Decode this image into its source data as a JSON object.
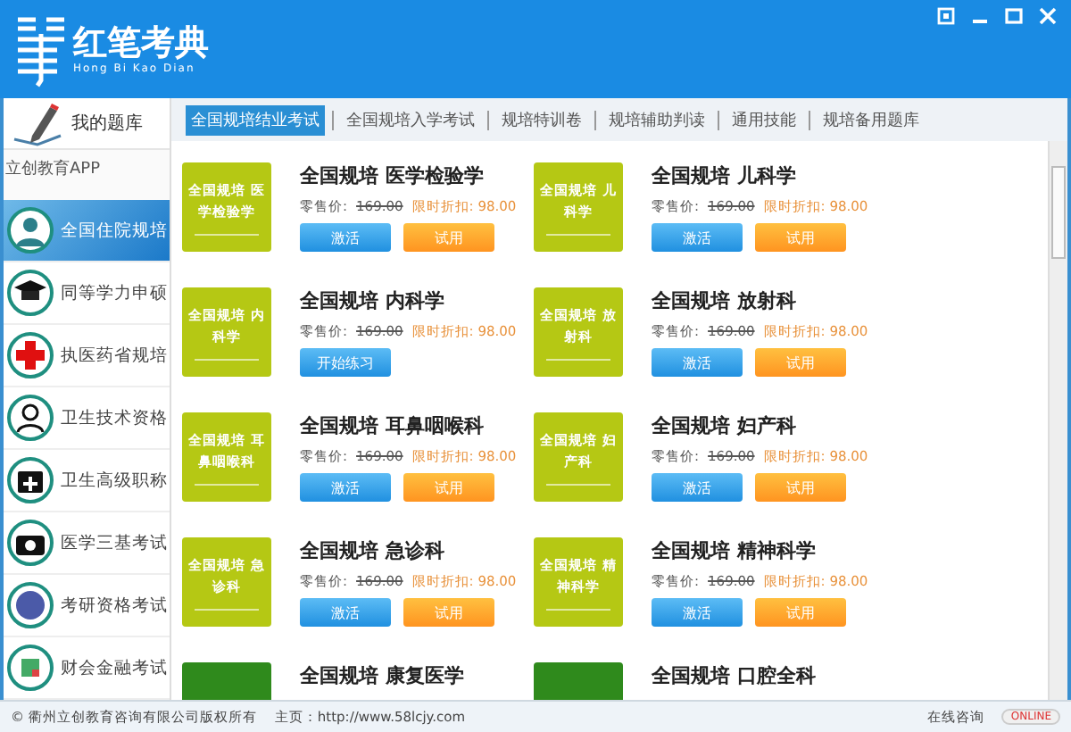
{
  "app": {
    "logo_title": "红笔考典",
    "logo_subtitle": "Hong Bi Kao Dian"
  },
  "sidebar": {
    "header": "我的题库",
    "app_label": "立创教育APP",
    "items": [
      {
        "label": "全国住院规培",
        "selected": true
      },
      {
        "label": "同等学力申硕",
        "selected": false
      },
      {
        "label": "执医药省规培",
        "selected": false
      },
      {
        "label": "卫生技术资格",
        "selected": false
      },
      {
        "label": "卫生高级职称",
        "selected": false
      },
      {
        "label": "医学三基考试",
        "selected": false
      },
      {
        "label": "考研资格考试",
        "selected": false
      },
      {
        "label": "财会金融考试",
        "selected": false
      }
    ]
  },
  "tabs": [
    {
      "label": "全国规培结业考试",
      "selected": true
    },
    {
      "label": "全国规培入学考试",
      "selected": false
    },
    {
      "label": "规培特训卷",
      "selected": false
    },
    {
      "label": "规培辅助判读",
      "selected": false
    },
    {
      "label": "通用技能",
      "selected": false
    },
    {
      "label": "规培备用题库",
      "selected": false
    }
  ],
  "cards": [
    {
      "thumb_text": "全国规培 医学检验学",
      "color": "#b5c814",
      "title": "全国规培 医学检验学",
      "price_label": "零售价:",
      "price": "169.00",
      "sale_label": "限时折扣:",
      "sale_price": "98.00",
      "buttons": [
        {
          "kind": "primary",
          "label": "激活"
        },
        {
          "kind": "secondary",
          "label": "试用"
        }
      ]
    },
    {
      "thumb_text": "全国规培 儿科学",
      "color": "#b5c814",
      "title": "全国规培 儿科学",
      "price_label": "零售价:",
      "price": "169.00",
      "sale_label": "限时折扣:",
      "sale_price": "98.00",
      "buttons": [
        {
          "kind": "primary",
          "label": "激活"
        },
        {
          "kind": "secondary",
          "label": "试用"
        }
      ]
    },
    {
      "thumb_text": "全国规培 内科学",
      "color": "#b5c814",
      "title": "全国规培 内科学",
      "price_label": "零售价:",
      "price": "169.00",
      "sale_label": "限时折扣:",
      "sale_price": "98.00",
      "buttons": [
        {
          "kind": "primary",
          "label": "开始练习"
        }
      ]
    },
    {
      "thumb_text": "全国规培 放射科",
      "color": "#b5c814",
      "title": "全国规培 放射科",
      "price_label": "零售价:",
      "price": "169.00",
      "sale_label": "限时折扣:",
      "sale_price": "98.00",
      "buttons": [
        {
          "kind": "primary",
          "label": "激活"
        },
        {
          "kind": "secondary",
          "label": "试用"
        }
      ]
    },
    {
      "thumb_text": "全国规培 耳鼻咽喉科",
      "color": "#b5c814",
      "title": "全国规培 耳鼻咽喉科",
      "price_label": "零售价:",
      "price": "169.00",
      "sale_label": "限时折扣:",
      "sale_price": "98.00",
      "buttons": [
        {
          "kind": "primary",
          "label": "激活"
        },
        {
          "kind": "secondary",
          "label": "试用"
        }
      ]
    },
    {
      "thumb_text": "全国规培 妇产科",
      "color": "#b5c814",
      "title": "全国规培 妇产科",
      "price_label": "零售价:",
      "price": "169.00",
      "sale_label": "限时折扣:",
      "sale_price": "98.00",
      "buttons": [
        {
          "kind": "primary",
          "label": "激活"
        },
        {
          "kind": "secondary",
          "label": "试用"
        }
      ]
    },
    {
      "thumb_text": "全国规培 急诊科",
      "color": "#b5c814",
      "title": "全国规培 急诊科",
      "price_label": "零售价:",
      "price": "169.00",
      "sale_label": "限时折扣:",
      "sale_price": "98.00",
      "buttons": [
        {
          "kind": "primary",
          "label": "激活"
        },
        {
          "kind": "secondary",
          "label": "试用"
        }
      ]
    },
    {
      "thumb_text": "全国规培 精神科学",
      "color": "#b5c814",
      "title": "全国规培 精神科学",
      "price_label": "零售价:",
      "price": "169.00",
      "sale_label": "限时折扣:",
      "sale_price": "98.00",
      "buttons": [
        {
          "kind": "primary",
          "label": "激活"
        },
        {
          "kind": "secondary",
          "label": "试用"
        }
      ]
    },
    {
      "color": "#2f8a1c",
      "title": "全国规培 康复医学"
    },
    {
      "color": "#2f8a1c",
      "title": "全国规培 口腔全科"
    }
  ],
  "status_bar": {
    "copyright": "© 衢州立创教育咨询有限公司版权所有",
    "homepage": "主页：http://www.58lcjy.com",
    "consult": "在线咨询",
    "badge": "ONLINE"
  }
}
